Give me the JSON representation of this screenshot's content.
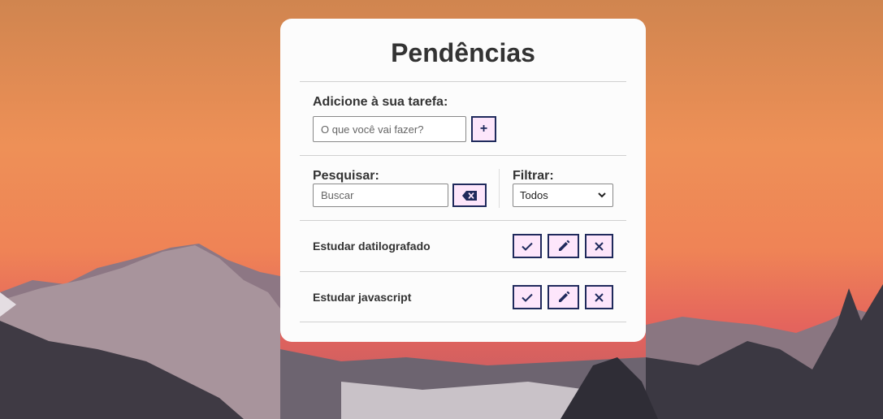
{
  "title": "Pendências",
  "add": {
    "label": "Adicione à sua tarefa:",
    "placeholder": "O que você vai fazer?",
    "value": "",
    "button_icon": "plus-icon",
    "button_symbol": "+"
  },
  "search": {
    "label": "Pesquisar:",
    "placeholder": "Buscar",
    "value": "",
    "clear_icon": "backspace-icon"
  },
  "filter": {
    "label": "Filtrar:",
    "selected": "Todos"
  },
  "todos": [
    {
      "text": "Estudar datilografado"
    },
    {
      "text": "Estudar javascript"
    }
  ],
  "actions": {
    "done_icon": "check-icon",
    "edit_icon": "pencil-icon",
    "remove_icon": "close-icon"
  },
  "colors": {
    "button_bg": "#fde6fb",
    "button_border": "#1f2a5c",
    "card_bg": "#fcfcfc",
    "text": "#333333"
  }
}
